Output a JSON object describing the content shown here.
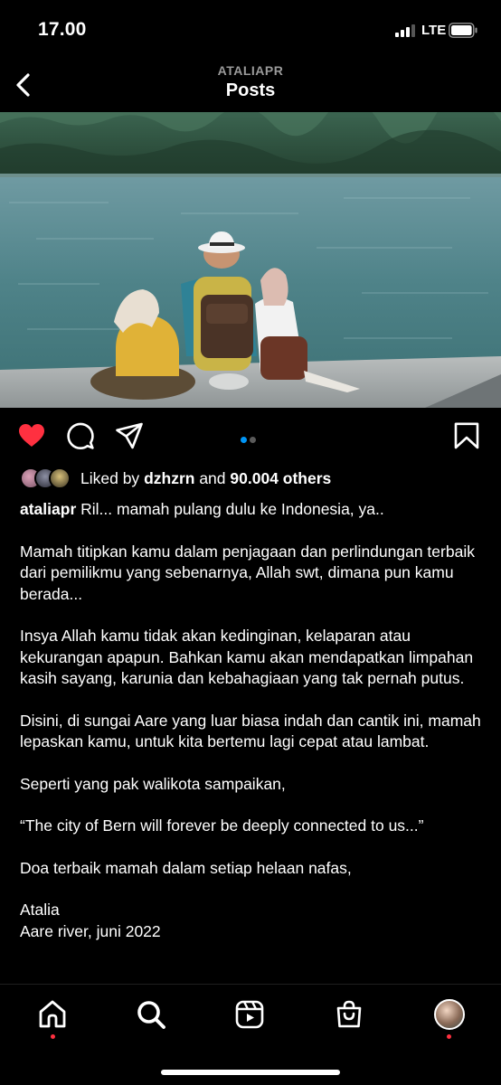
{
  "status_bar": {
    "time": "17.00",
    "network": "LTE",
    "icons": [
      "signal-bars-icon",
      "battery-icon"
    ]
  },
  "header": {
    "username": "ATALIAPR",
    "title": "Posts",
    "back_icon": "chevron-left-icon"
  },
  "post": {
    "image_icon": "photo",
    "carousel": {
      "count": 2,
      "active_index": 0,
      "active_color": "#0095f6",
      "inactive_color": "#5a5a5a"
    },
    "actions": {
      "like_icon": "heart-filled-icon",
      "like_color": "#ff3040",
      "comment_icon": "comment-icon",
      "share_icon": "send-icon",
      "save_icon": "bookmark-icon"
    },
    "likes": {
      "prefix": "Liked by",
      "user": "dzhzrn",
      "joiner": "and",
      "others": "90.004 others"
    },
    "caption": {
      "username": "ataliapr",
      "paragraphs": [
        "Ril... mamah pulang dulu ke Indonesia, ya..",
        "Mamah titipkan kamu dalam penjagaan dan perlindungan terbaik dari pemilikmu yang sebenarnya, Allah swt, dimana pun kamu berada...",
        "Insya Allah kamu tidak akan kedinginan, kelaparan atau kekurangan apapun. Bahkan kamu akan mendapatkan limpahan kasih sayang, karunia dan kebahagiaan yang tak pernah putus.",
        "Disini, di sungai Aare yang luar biasa indah dan cantik ini, mamah lepaskan kamu, untuk kita bertemu lagi cepat atau lambat.",
        "Seperti yang pak walikota sampaikan,",
        "“The city of Bern will forever be deeply connected to us...”",
        "Doa terbaik mamah dalam setiap helaan nafas,",
        "Atalia",
        "Aare river, juni 2022"
      ]
    }
  },
  "tab_bar": {
    "items": [
      "home-icon",
      "search-icon",
      "reels-icon",
      "shop-icon",
      "profile-avatar"
    ],
    "notification_color": "#ff3040"
  }
}
